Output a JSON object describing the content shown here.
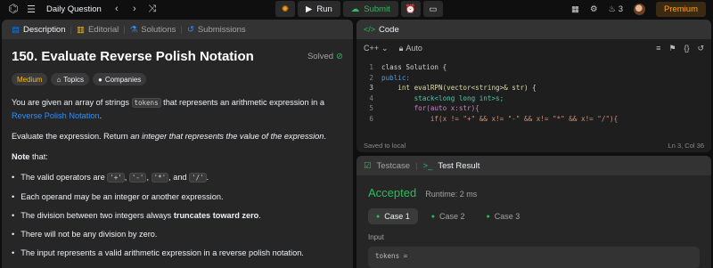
{
  "topbar": {
    "title": "Daily Question",
    "run_label": "Run",
    "submit_label": "Submit",
    "streak_count": "3",
    "premium_label": "Premium"
  },
  "left": {
    "tabs": [
      {
        "label": "Description"
      },
      {
        "label": "Editorial"
      },
      {
        "label": "Solutions"
      },
      {
        "label": "Submissions"
      }
    ],
    "problem_title": "150. Evaluate Reverse Polish Notation",
    "solved_label": "Solved",
    "badges": {
      "difficulty": "Medium",
      "topics": "Topics",
      "companies": "Companies"
    },
    "p1_a": "You are given an array of strings ",
    "p1_code": "tokens",
    "p1_b": " that represents an arithmetic expression in a ",
    "p1_link": "Reverse Polish Notation",
    "p1_c": ".",
    "p2_a": "Evaluate the expression. Return ",
    "p2_em": "an integer that represents the value of the expression",
    "p2_b": ".",
    "note_bold": "Note",
    "note_rest": " that:",
    "bullet1_a": "The valid operators are ",
    "op1": "'+'",
    "op2": "'-'",
    "op3": "'*'",
    "op4": "'/'",
    "sep_comma": ", ",
    "sep_and": ", and ",
    "bullet1_end": ".",
    "bullet2": "Each operand may be an integer or another expression.",
    "bullet3_a": "The division between two integers always ",
    "bullet3_bold": "truncates toward zero",
    "bullet3_b": ".",
    "bullet4": "There will not be any division by zero.",
    "bullet5": "The input represents a valid arithmetic expression in a reverse polish notation."
  },
  "code_panel": {
    "title": "Code",
    "language": "C++",
    "mode": "Auto",
    "lines": [
      {
        "n": "1",
        "t": "class Solution {"
      },
      {
        "n": "2",
        "t": "public:"
      },
      {
        "n": "3",
        "t": "    int evalRPN(vector<string>& str) {"
      },
      {
        "n": "4",
        "t": "        stack<long long int>s;"
      },
      {
        "n": "5",
        "t": "        for(auto x:str){"
      },
      {
        "n": "6",
        "t": "            if(x != \"+\" && x!= \"-\" && x!= \"*\" && x!= \"/\"){"
      }
    ],
    "status_left": "Saved to local",
    "status_right": "Ln 3, Col 36"
  },
  "test_panel": {
    "tab_testcase": "Testcase",
    "tab_result": "Test Result",
    "result": "Accepted",
    "runtime": "Runtime: 2 ms",
    "cases": [
      "Case 1",
      "Case 2",
      "Case 3"
    ],
    "input_label": "Input",
    "input_value": "tokens ="
  },
  "colors": {
    "accent_green": "#2cbb5d",
    "medium_yellow": "#ffb800",
    "premium_orange": "#ffa116",
    "link_blue": "#2f8fff"
  }
}
